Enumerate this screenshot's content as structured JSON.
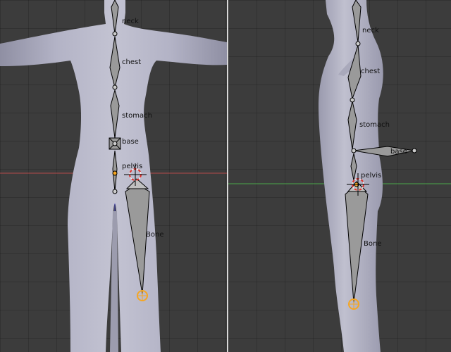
{
  "front_view": {
    "bones": {
      "neck": "neck",
      "chest": "chest",
      "stomach": "stomach",
      "base": "base",
      "pelvis": "pelvis",
      "bone": "Bone"
    }
  },
  "side_view": {
    "bones": {
      "neck": "neck",
      "chest": "chest",
      "stomach": "stomach",
      "base": "base",
      "pelvis": "pelvis",
      "bone": "Bone"
    }
  },
  "colors": {
    "mesh": "#b3b3c6",
    "bone_fill": "#9a9a9a",
    "bone_outline": "#000000",
    "selected_joint": "#f5a623",
    "x_axis": "#b34a4a",
    "y_axis": "#4aa84a",
    "z_axis": "#4a4ac8",
    "cursor": "#e0302a",
    "divider": "#d8d8d8"
  },
  "icons": [
    "3d-cursor-icon",
    "bone-joint-icon"
  ]
}
